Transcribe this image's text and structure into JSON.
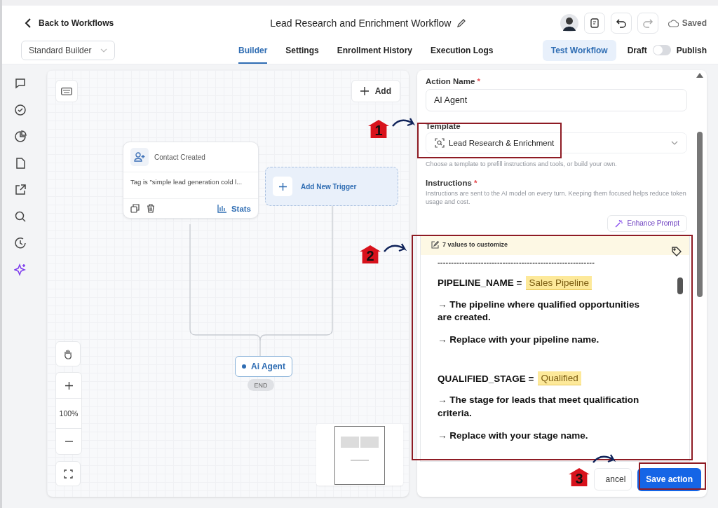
{
  "header": {
    "back_label": "Back to Workflows",
    "title": "Lead Research and Enrichment Workflow",
    "status": "Saved"
  },
  "toolbar": {
    "builder_mode": "Standard Builder",
    "tabs": [
      {
        "label": "Builder",
        "selected": true
      },
      {
        "label": "Settings",
        "selected": false
      },
      {
        "label": "Enrollment History",
        "selected": false
      },
      {
        "label": "Execution Logs",
        "selected": false
      }
    ],
    "test_button": "Test Workflow",
    "toggle": {
      "off_label": "Draft",
      "on_label": "Publish",
      "on": false
    }
  },
  "sidebar": {
    "items": [
      {
        "kind": "chat"
      },
      {
        "kind": "check"
      },
      {
        "kind": "pie"
      },
      {
        "kind": "file"
      },
      {
        "kind": "export"
      },
      {
        "kind": "search"
      },
      {
        "kind": "history"
      },
      {
        "kind": "sparkle"
      }
    ]
  },
  "canvas": {
    "add_button": "Add",
    "trigger": {
      "title": "Contact Created",
      "condition": "Tag is \"simple lead generation cold l...",
      "stats": "Stats"
    },
    "add_trigger": "Add New Trigger",
    "action_node": "Ai Agent",
    "end_label": "END",
    "zoom": "100%"
  },
  "panel": {
    "action_name": {
      "label": "Action Name",
      "required_mark": "*",
      "value": "AI Agent"
    },
    "template": {
      "label": "Template",
      "value": "Lead Research & Enrichment",
      "help": "Choose a template to prefill instructions and tools, or build your own."
    },
    "instructions": {
      "label": "Instructions",
      "required_mark": "*",
      "help": "Instructions are sent to the AI model on every turn. Keeping them focused helps reduce token usage and cost.",
      "enhance_button": "Enhance Prompt",
      "banner": "7 values to customize",
      "blocks": [
        {
          "kind": "rule",
          "text": "----------------------------------------------------------"
        },
        {
          "kind": "variable",
          "name": "PIPELINE_NAME =",
          "value": "Sales Pipeline"
        },
        {
          "kind": "note",
          "text": "→ The pipeline where qualified opportunities are created."
        },
        {
          "kind": "note",
          "text": "→ Replace with your pipeline name."
        },
        {
          "kind": "variable",
          "name": "QUALIFIED_STAGE =",
          "value": "Qualified"
        },
        {
          "kind": "note",
          "text": "→ The stage for leads that meet qualification criteria."
        },
        {
          "kind": "note",
          "text": "→ Replace with your stage name."
        }
      ]
    },
    "cancel": "ancel",
    "save": "Save action"
  },
  "annotations": [
    "1",
    "2",
    "3"
  ]
}
